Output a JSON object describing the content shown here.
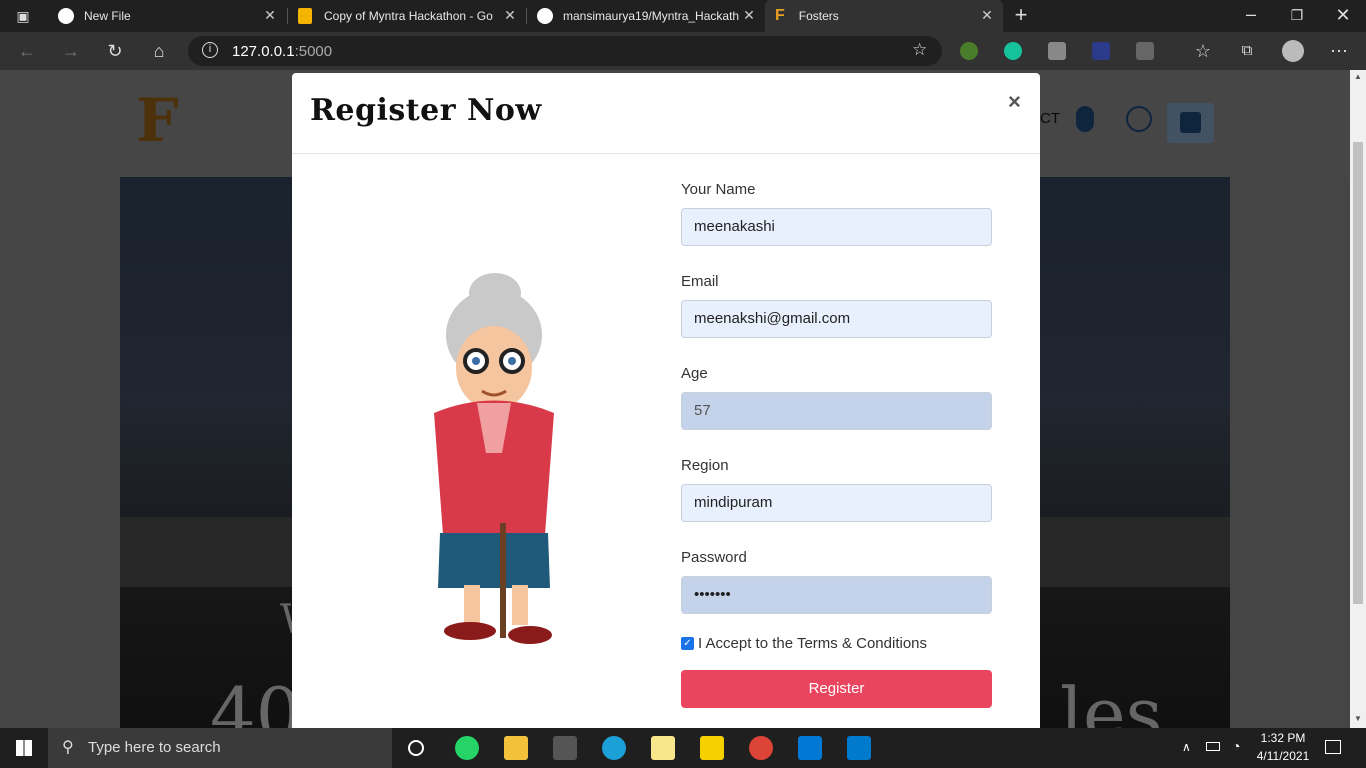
{
  "tabs": [
    {
      "title": "New File",
      "icon": "github-icon"
    },
    {
      "title": "Copy of Myntra Hackathon - Go",
      "icon": "slides-icon"
    },
    {
      "title": "mansimaurya19/Myntra_Hackath",
      "icon": "github-icon"
    },
    {
      "title": "Fosters",
      "icon": "fosters-icon",
      "active": true
    }
  ],
  "address": {
    "host": "127.0.0.1",
    "port": ":5000"
  },
  "header": {
    "nav_partial": "CT"
  },
  "hero": {
    "text_left": "40",
    "text_right": "les",
    "text_small": "W"
  },
  "modal": {
    "title": "Register Now",
    "close": "×",
    "fields": [
      {
        "label": "Your Name",
        "value": "meenakashi"
      },
      {
        "label": "Email",
        "value": "meenakshi@gmail.com"
      },
      {
        "label": "Age",
        "value": "57"
      },
      {
        "label": "Region",
        "value": "mindipuram"
      },
      {
        "label": "Password",
        "value": "•••••••"
      }
    ],
    "terms": "I Accept to the Terms & Conditions",
    "terms_checked": true,
    "register": "Register"
  },
  "taskbar": {
    "search_placeholder": "Type here to search",
    "time": "1:32 PM",
    "date": "4/11/2021"
  },
  "colors": {
    "accent": "#e9455e",
    "field_bg": "#e8f0fe",
    "brand": "#e8a020"
  }
}
